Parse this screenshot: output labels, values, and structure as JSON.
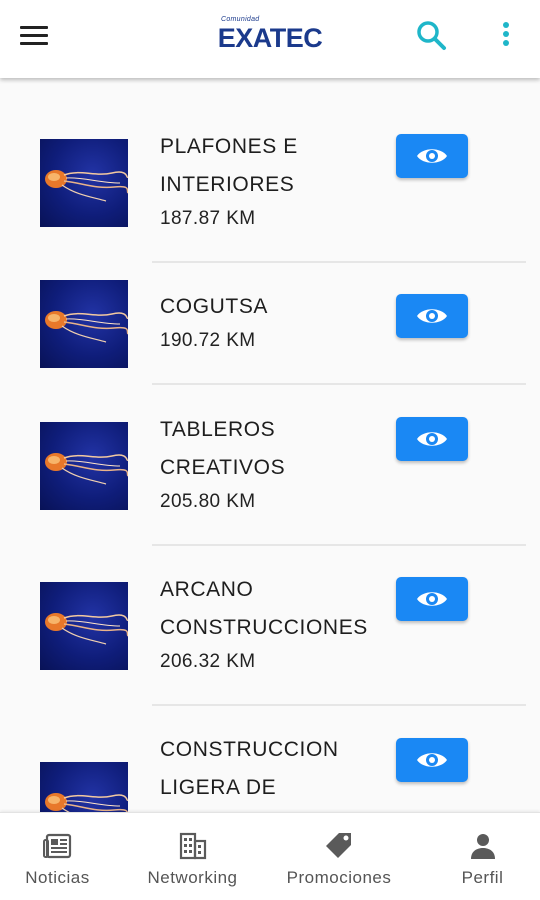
{
  "header": {
    "logo_small": "Comunidad",
    "logo_main": "EXATEC",
    "menu_icon": "hamburger-menu-icon",
    "search_icon": "search-icon",
    "more_icon": "more-vertical-icon",
    "accent_color": "#1fb6c9",
    "brand_color": "#1b3a8c"
  },
  "list": {
    "button_color": "#1a88f4",
    "button_icon": "eye-icon",
    "items": [
      {
        "name_line1": "PLAFONES E",
        "name_line2": "INTERIORES",
        "distance": "187.87 KM"
      },
      {
        "name_line1": "COGUTSA",
        "name_line2": "",
        "distance": "190.72 KM"
      },
      {
        "name_line1": "TABLEROS",
        "name_line2": "CREATIVOS",
        "distance": "205.80 KM"
      },
      {
        "name_line1": "ARCANO",
        "name_line2": "CONSTRUCCIONES",
        "distance": "206.32 KM"
      },
      {
        "name_line1": "CONSTRUCCION",
        "name_line2": "LIGERA DE",
        "distance": ""
      }
    ]
  },
  "bottom_nav": {
    "items": [
      {
        "label": "Noticias",
        "icon": "newspaper-icon"
      },
      {
        "label": "Networking",
        "icon": "building-icon"
      },
      {
        "label": "Promociones",
        "icon": "tag-icon"
      },
      {
        "label": "Perfil",
        "icon": "person-icon"
      }
    ]
  }
}
